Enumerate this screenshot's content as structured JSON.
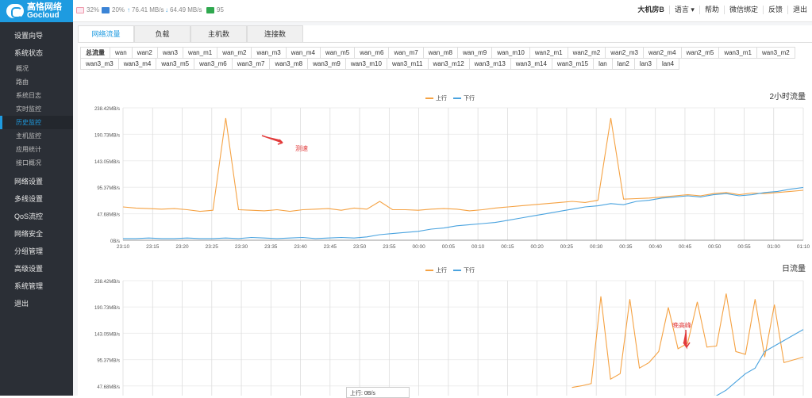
{
  "app": {
    "brand_cn": "高恪网络",
    "brand_en": "Gocloud"
  },
  "topbar": {
    "cpu": "32%",
    "mem": "20%",
    "upload": "76.41 MB/s",
    "download": "64.49 MB/s",
    "clients": "95",
    "menu": [
      "大机房B",
      "语言 ▾",
      "帮助",
      "微信绑定",
      "反馈",
      "退出"
    ]
  },
  "sidebar": {
    "items": [
      {
        "label": "设置向导",
        "type": "nav"
      },
      {
        "label": "系统状态",
        "type": "nav"
      },
      {
        "label": "概况",
        "type": "sub"
      },
      {
        "label": "路由",
        "type": "sub"
      },
      {
        "label": "系统日志",
        "type": "sub"
      },
      {
        "label": "实时监控",
        "type": "sub"
      },
      {
        "label": "历史监控",
        "type": "sub",
        "active": true
      },
      {
        "label": "主机监控",
        "type": "sub"
      },
      {
        "label": "应用统计",
        "type": "sub"
      },
      {
        "label": "接口概况",
        "type": "sub"
      },
      {
        "label": "网络设置",
        "type": "nav"
      },
      {
        "label": "多线设置",
        "type": "nav"
      },
      {
        "label": "QoS流控",
        "type": "nav"
      },
      {
        "label": "网络安全",
        "type": "nav"
      },
      {
        "label": "分组管理",
        "type": "nav"
      },
      {
        "label": "高级设置",
        "type": "nav"
      },
      {
        "label": "系统管理",
        "type": "nav"
      },
      {
        "label": "退出",
        "type": "nav"
      }
    ]
  },
  "tabs": [
    "网络流量",
    "负载",
    "主机数",
    "连接数"
  ],
  "interfaces": [
    "总流量",
    "wan",
    "wan2",
    "wan3",
    "wan_m1",
    "wan_m2",
    "wan_m3",
    "wan_m4",
    "wan_m5",
    "wan_m6",
    "wan_m7",
    "wan_m8",
    "wan_m9",
    "wan_m10",
    "wan2_m1",
    "wan2_m2",
    "wan2_m3",
    "wan2_m4",
    "wan2_m5",
    "wan3_m1",
    "wan3_m2",
    "wan3_m3",
    "wan3_m4",
    "wan3_m5",
    "wan3_m6",
    "wan3_m7",
    "wan3_m8",
    "wan3_m9",
    "wan3_m10",
    "wan3_m11",
    "wan3_m12",
    "wan3_m13",
    "wan3_m14",
    "wan3_m15",
    "lan",
    "lan2",
    "lan3",
    "lan4"
  ],
  "colors": {
    "up": "#f5a243",
    "down": "#4aa3df",
    "accent": "#1e9be0",
    "annot": "#e23a3a"
  },
  "chart_data": [
    {
      "type": "line",
      "title": "2小时流量",
      "legend": [
        "上行",
        "下行"
      ],
      "y_ticks": [
        "0B/s",
        "47.68MB/s",
        "95.37MB/s",
        "143.05MB/s",
        "190.73MB/s",
        "238.42MB/s"
      ],
      "x": [
        "23:10",
        "23:15",
        "23:20",
        "23:25",
        "23:30",
        "23:35",
        "23:40",
        "23:45",
        "23:50",
        "23:55",
        "00:00",
        "00:05",
        "00:10",
        "00:15",
        "00:20",
        "00:25",
        "00:30",
        "00:35",
        "00:40",
        "00:45",
        "00:50",
        "00:55",
        "01:00",
        "01:10"
      ],
      "annotation": "测速",
      "series": [
        {
          "name": "上行",
          "values": [
            60,
            58,
            57,
            56,
            57,
            55,
            52,
            54,
            220,
            55,
            54,
            53,
            55,
            52,
            55,
            56,
            57,
            54,
            58,
            56,
            70,
            55,
            55,
            54,
            56,
            57,
            56,
            53,
            55,
            58,
            60,
            62,
            64,
            66,
            68,
            70,
            68,
            72,
            220,
            74,
            75,
            76,
            78,
            80,
            82,
            80,
            84,
            86,
            82,
            85,
            84,
            86,
            88,
            90
          ]
        },
        {
          "name": "下行",
          "values": [
            3,
            3,
            4,
            3,
            3,
            4,
            3,
            3,
            4,
            3,
            5,
            4,
            3,
            4,
            5,
            3,
            4,
            5,
            4,
            6,
            10,
            12,
            14,
            16,
            20,
            22,
            26,
            28,
            30,
            32,
            36,
            40,
            44,
            48,
            52,
            56,
            60,
            62,
            66,
            64,
            70,
            72,
            76,
            78,
            80,
            78,
            82,
            84,
            80,
            82,
            86,
            88,
            92,
            95
          ]
        }
      ]
    },
    {
      "type": "line",
      "title": "日流量",
      "legend": [
        "上行",
        "下行"
      ],
      "y_ticks": [
        "47.68MB/s",
        "95.37MB/s",
        "143.05MB/s",
        "190.73MB/s",
        "238.42MB/s"
      ],
      "annotation": "晚高峰",
      "series": [
        {
          "name": "上行",
          "values": [
            45,
            48,
            52,
            210,
            60,
            70,
            205,
            80,
            90,
            110,
            190,
            115,
            125,
            200,
            118,
            120,
            215,
            110,
            105,
            205,
            100,
            195,
            90,
            95,
            100
          ]
        },
        {
          "name": "下行",
          "values": [
            5,
            10,
            8,
            12,
            15,
            10,
            12,
            14,
            18,
            20,
            16,
            18,
            22,
            20,
            24,
            30,
            40,
            55,
            70,
            80,
            110,
            120,
            130,
            140,
            150
          ]
        }
      ]
    }
  ],
  "tooltip": {
    "text": "上行: 0B/s"
  }
}
